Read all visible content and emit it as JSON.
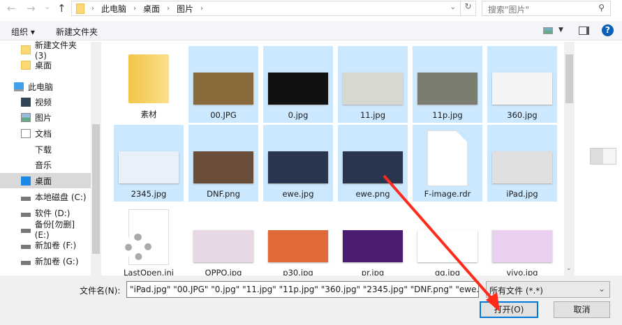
{
  "nav_buttons": {
    "back": "←",
    "forward": "→",
    "recent": "⌄",
    "up": "↑"
  },
  "breadcrumb": [
    "此电脑",
    "桌面",
    "图片"
  ],
  "search": {
    "placeholder": "搜索\"图片\""
  },
  "toolbar": {
    "organize": "组织 ▾",
    "new_folder": "新建文件夹"
  },
  "sidebar": {
    "items": [
      {
        "label": "新建文件夹 (3)",
        "icon": "folder-icon"
      },
      {
        "label": "桌面",
        "icon": "folder-icon"
      },
      {
        "label": "此电脑",
        "icon": "computer-icon"
      },
      {
        "label": "视频",
        "icon": "video-icon"
      },
      {
        "label": "图片",
        "icon": "picture-icon"
      },
      {
        "label": "文档",
        "icon": "document-icon"
      },
      {
        "label": "下载",
        "icon": "download-icon"
      },
      {
        "label": "音乐",
        "icon": "music-icon"
      },
      {
        "label": "桌面",
        "icon": "desktop-icon",
        "selected": true
      },
      {
        "label": "本地磁盘 (C:)",
        "icon": "drive-icon"
      },
      {
        "label": "软件 (D:)",
        "icon": "drive-icon"
      },
      {
        "label": "备份[勿删] (E:)",
        "icon": "drive-icon"
      },
      {
        "label": "新加卷 (F:)",
        "icon": "drive-icon"
      },
      {
        "label": "新加卷 (G:)",
        "icon": "drive-icon"
      }
    ]
  },
  "files": [
    {
      "name": "素材",
      "kind": "folder",
      "selected": false,
      "color": "#f5c94a"
    },
    {
      "name": "00.JPG",
      "kind": "img",
      "selected": true,
      "color": "#8a6a3a"
    },
    {
      "name": "0.jpg",
      "kind": "img",
      "selected": true,
      "color": "#111111"
    },
    {
      "name": "11.jpg",
      "kind": "img",
      "selected": true,
      "color": "#d8d8d0"
    },
    {
      "name": "11p.jpg",
      "kind": "img",
      "selected": true,
      "color": "#7a7c70"
    },
    {
      "name": "360.jpg",
      "kind": "img",
      "selected": true,
      "color": "#f4f4f4"
    },
    {
      "name": "2345.jpg",
      "kind": "img",
      "selected": true,
      "color": "#e8f0fa"
    },
    {
      "name": "DNF.png",
      "kind": "img",
      "selected": true,
      "color": "#6b4e3a"
    },
    {
      "name": "ewe.jpg",
      "kind": "img",
      "selected": true,
      "color": "#2a3550"
    },
    {
      "name": "ewe.png",
      "kind": "img",
      "selected": true,
      "color": "#2a3550"
    },
    {
      "name": "F-image.rdr",
      "kind": "file",
      "selected": true,
      "color": "#ffffff"
    },
    {
      "name": "iPad.jpg",
      "kind": "img",
      "selected": true,
      "color": "#e0e0e0"
    },
    {
      "name": "LastOpen.ini",
      "kind": "ini",
      "selected": false,
      "color": "#ffffff"
    },
    {
      "name": "OPPO.jpg",
      "kind": "img",
      "selected": false,
      "color": "#e8d8e6"
    },
    {
      "name": "p30.jpg",
      "kind": "img",
      "selected": false,
      "color": "#e06a3a"
    },
    {
      "name": "pr.jpg",
      "kind": "img",
      "selected": false,
      "color": "#4a1d6e"
    },
    {
      "name": "qq.jpg",
      "kind": "img",
      "selected": false,
      "color": "#ffffff"
    },
    {
      "name": "vivo.jpg",
      "kind": "img",
      "selected": false,
      "color": "#e8d0ee"
    }
  ],
  "bottom": {
    "filename_label": "文件名(N):",
    "filename_value": "\"iPad.jpg\" \"00.JPG\" \"0.jpg\" \"11.jpg\" \"11p.jpg\" \"360.jpg\" \"2345.jpg\" \"DNF.png\" \"ewe.jpg\" \"",
    "filetype": "所有文件 (*.*)",
    "open": "打开(O)",
    "cancel": "取消"
  },
  "colors": {
    "selection": "#cce8ff",
    "accent": "#0078d7",
    "arrow": "#ff2a1a"
  }
}
